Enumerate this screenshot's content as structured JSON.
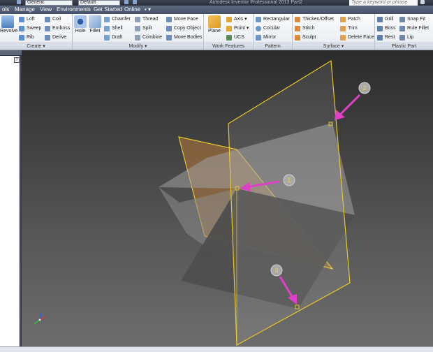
{
  "title_bar": {
    "style_combo": "Generic",
    "appearance_combo": "Default",
    "window_title": "Autodesk Inventor Professional 2013    Part2",
    "search_placeholder": "Type a keyword or phrase"
  },
  "tabs": [
    {
      "label": "ols"
    },
    {
      "label": "Manage"
    },
    {
      "label": "View"
    },
    {
      "label": "Environments"
    },
    {
      "label": "Get Started"
    },
    {
      "label": "Online"
    },
    {
      "label": "▪ ▾"
    }
  ],
  "ribbon": {
    "create": {
      "label": "Create ▾",
      "revolve": "Revolve",
      "items": [
        "Loft",
        "Sweep",
        "Rib",
        "Coil",
        "Emboss",
        "Derive"
      ]
    },
    "modify": {
      "label": "Modify ▾",
      "hole": "Hole",
      "fillet": "Fillet",
      "items": [
        "Chamfer",
        "Shell",
        "Draft",
        "Thread",
        "Split",
        "Combine",
        "Move Face",
        "Copy Object",
        "Move Bodies"
      ]
    },
    "work_features": {
      "label": "Work Features",
      "plane": "Plane",
      "items": [
        "Axis ▾",
        "Point ▾",
        "UCS"
      ]
    },
    "pattern": {
      "label": "Pattern",
      "items": [
        "Rectangular",
        "Cocular",
        "Mirror"
      ]
    },
    "surface": {
      "label": "Surface ▾",
      "items": [
        "Thicken/Offset",
        "Stitch",
        "Sculpt",
        "Patch",
        "Trim",
        "Delete Face"
      ]
    },
    "plastic_part": {
      "label": "Plastic Part",
      "items": [
        "Grill",
        "Boss",
        "Rest",
        "Snap Fit",
        "Rule Fillet",
        "Lip"
      ]
    }
  },
  "browser": {
    "toggle": "?"
  },
  "viewport": {
    "callouts": [
      "1",
      "2",
      "3"
    ],
    "accent": "#e040c8",
    "plane_color": "#e6c82a"
  }
}
